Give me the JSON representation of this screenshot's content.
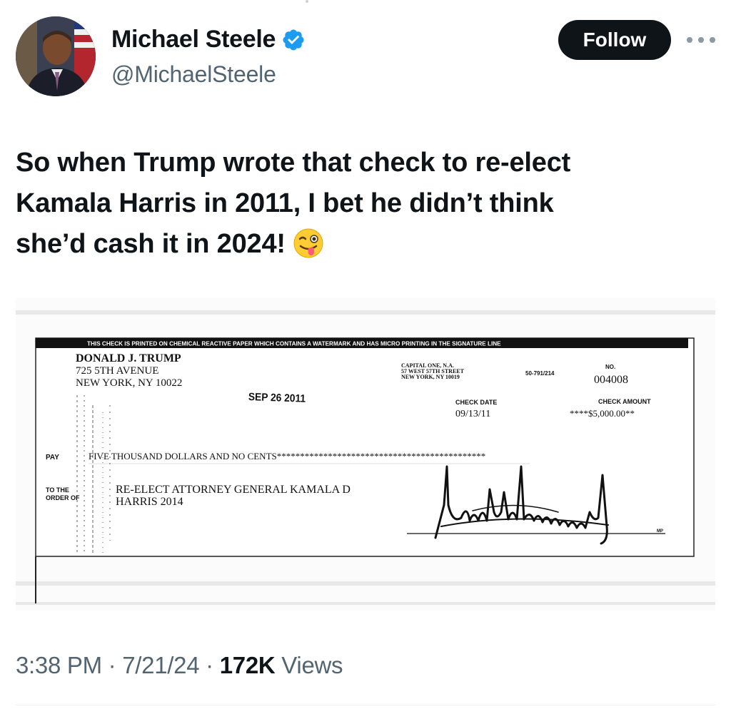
{
  "author": {
    "name": "Michael Steele",
    "handle": "@MichaelSteele",
    "verified_icon": "verified-badge-icon",
    "verified_color": "#1d9bf0"
  },
  "actions": {
    "follow_label": "Follow",
    "more_icon": "more-options-icon"
  },
  "tweet": {
    "lines": [
      "So when Trump wrote that check to re-elect",
      "Kamala Harris in 2011, I bet he didn’t think",
      "she’d cash it in 2024!"
    ],
    "emoji": "😜"
  },
  "check": {
    "security_banner": "THIS CHECK IS PRINTED ON CHEMICAL REACTIVE PAPER WHICH CONTAINS A WATERMARK AND HAS MICRO PRINTING IN THE SIGNATURE LINE",
    "payer_name": "DONALD J. TRUMP",
    "payer_address1": "725 5TH AVENUE",
    "payer_address2": "NEW YORK, NY 10022",
    "bank_name": "CAPITAL ONE, N.A.",
    "bank_address1": "57 WEST 57TH STREET",
    "bank_address2": "NEW YORK, NY 10019",
    "routing": "50-791/214",
    "no_label": "NO.",
    "check_number": "004008",
    "stamp_date": "SEP 26 2011",
    "check_date_label": "CHECK DATE",
    "check_date": "09/13/11",
    "amount_label": "CHECK AMOUNT",
    "amount": "****$5,000.00**",
    "pay_label": "PAY",
    "amount_words": "FIVE THOUSAND  DOLLARS AND NO CENTS*********************************************",
    "to_the_label": "TO THE",
    "order_of_label": "ORDER OF",
    "payee_line1": "RE-ELECT ATTORNEY GENERAL KAMALA D",
    "payee_line2": "HARRIS 2014",
    "mp_label": "MP"
  },
  "meta": {
    "time": "3:38 PM",
    "separator": "·",
    "date": "7/21/24",
    "views_count": "172K",
    "views_label": "Views"
  }
}
